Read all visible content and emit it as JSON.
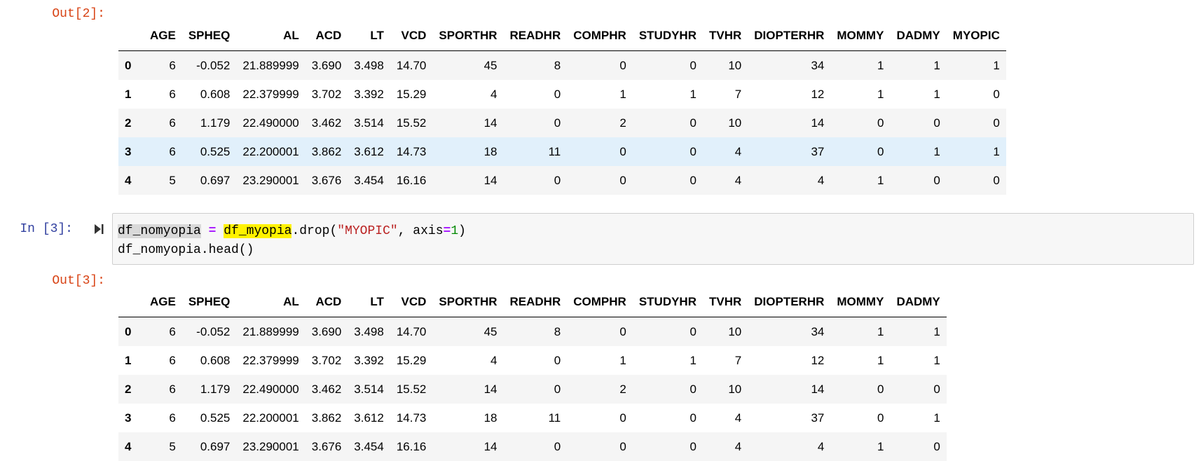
{
  "cells": {
    "out2": {
      "prompt": "Out[2]:"
    },
    "in3": {
      "prompt": "In [3]:",
      "code": {
        "line1": {
          "var": "df_nomyopia",
          "eq": " = ",
          "obj": "df_myopia",
          "call": ".drop(",
          "arg_str": "\"MYOPIC\"",
          "sep": ", axis",
          "op2": "=",
          "num": "1",
          "close": ")"
        },
        "line2": "df_nomyopia.head()"
      }
    },
    "out3": {
      "prompt": "Out[3]:"
    }
  },
  "table1": {
    "columns": [
      "AGE",
      "SPHEQ",
      "AL",
      "ACD",
      "LT",
      "VCD",
      "SPORTHR",
      "READHR",
      "COMPHR",
      "STUDYHR",
      "TVHR",
      "DIOPTERHR",
      "MOMMY",
      "DADMY",
      "MYOPIC"
    ],
    "rows": [
      {
        "index": "0",
        "values": [
          "6",
          "-0.052",
          "21.889999",
          "3.690",
          "3.498",
          "14.70",
          "45",
          "8",
          "0",
          "0",
          "10",
          "34",
          "1",
          "1",
          "1"
        ]
      },
      {
        "index": "1",
        "values": [
          "6",
          "0.608",
          "22.379999",
          "3.702",
          "3.392",
          "15.29",
          "4",
          "0",
          "1",
          "1",
          "7",
          "12",
          "1",
          "1",
          "0"
        ]
      },
      {
        "index": "2",
        "values": [
          "6",
          "1.179",
          "22.490000",
          "3.462",
          "3.514",
          "15.52",
          "14",
          "0",
          "2",
          "0",
          "10",
          "14",
          "0",
          "0",
          "0"
        ]
      },
      {
        "index": "3",
        "values": [
          "6",
          "0.525",
          "22.200001",
          "3.862",
          "3.612",
          "14.73",
          "18",
          "11",
          "0",
          "0",
          "4",
          "37",
          "0",
          "1",
          "1"
        ]
      },
      {
        "index": "4",
        "values": [
          "5",
          "0.697",
          "23.290001",
          "3.676",
          "3.454",
          "16.16",
          "14",
          "0",
          "0",
          "0",
          "4",
          "4",
          "1",
          "0",
          "0"
        ]
      }
    ]
  },
  "table2": {
    "columns": [
      "AGE",
      "SPHEQ",
      "AL",
      "ACD",
      "LT",
      "VCD",
      "SPORTHR",
      "READHR",
      "COMPHR",
      "STUDYHR",
      "TVHR",
      "DIOPTERHR",
      "MOMMY",
      "DADMY"
    ],
    "rows": [
      {
        "index": "0",
        "values": [
          "6",
          "-0.052",
          "21.889999",
          "3.690",
          "3.498",
          "14.70",
          "45",
          "8",
          "0",
          "0",
          "10",
          "34",
          "1",
          "1"
        ]
      },
      {
        "index": "1",
        "values": [
          "6",
          "0.608",
          "22.379999",
          "3.702",
          "3.392",
          "15.29",
          "4",
          "0",
          "1",
          "1",
          "7",
          "12",
          "1",
          "1"
        ]
      },
      {
        "index": "2",
        "values": [
          "6",
          "1.179",
          "22.490000",
          "3.462",
          "3.514",
          "15.52",
          "14",
          "0",
          "2",
          "0",
          "10",
          "14",
          "0",
          "0"
        ]
      },
      {
        "index": "3",
        "values": [
          "6",
          "0.525",
          "22.200001",
          "3.862",
          "3.612",
          "14.73",
          "18",
          "11",
          "0",
          "0",
          "4",
          "37",
          "0",
          "1"
        ]
      },
      {
        "index": "4",
        "values": [
          "5",
          "0.697",
          "23.290001",
          "3.676",
          "3.454",
          "16.16",
          "14",
          "0",
          "0",
          "0",
          "4",
          "4",
          "1",
          "0"
        ]
      }
    ]
  },
  "icons": {
    "run": "run-cell-icon"
  },
  "colors": {
    "out_prompt": "#d84315",
    "in_prompt": "#303f9f",
    "row_highlight": "#e1f0fb",
    "search_highlight": "#fff200"
  }
}
